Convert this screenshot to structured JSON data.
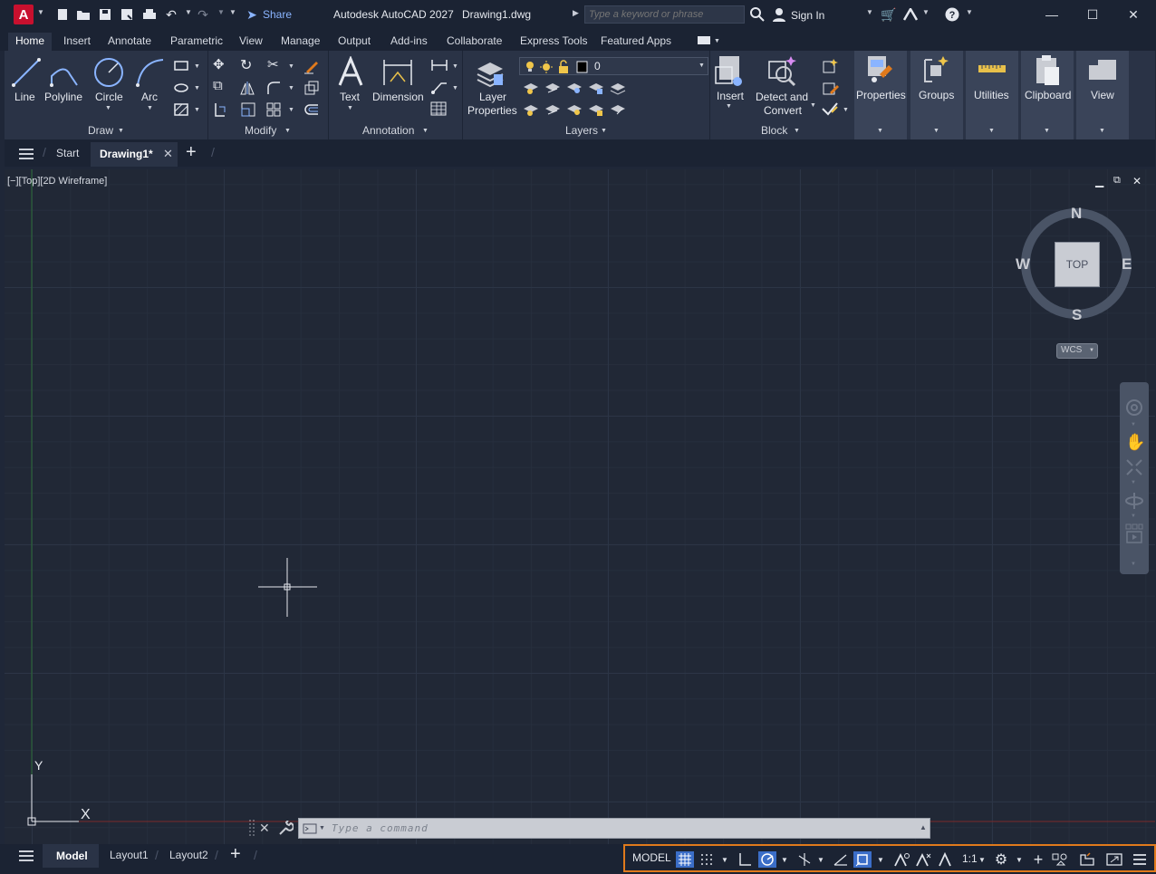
{
  "titlebar": {
    "app_logo": "A",
    "share_label": "Share",
    "app_title": "Autodesk AutoCAD 2027",
    "doc_title": "Drawing1.dwg",
    "search_placeholder": "Type a keyword or phrase",
    "signin_label": "Sign In"
  },
  "ribbon_tabs": [
    "Home",
    "Insert",
    "Annotate",
    "Parametric",
    "View",
    "Manage",
    "Output",
    "Add-ins",
    "Collaborate",
    "Express Tools",
    "Featured Apps"
  ],
  "active_tab": "Home",
  "ribbon": {
    "draw": {
      "title": "Draw",
      "line": "Line",
      "polyline": "Polyline",
      "circle": "Circle",
      "arc": "Arc"
    },
    "modify": {
      "title": "Modify"
    },
    "annotation": {
      "title": "Annotation",
      "text": "Text",
      "dimension": "Dimension"
    },
    "layers": {
      "title": "Layers",
      "layer_props_1": "Layer",
      "layer_props_2": "Properties",
      "current_layer": "0"
    },
    "block": {
      "title": "Block",
      "insert": "Insert",
      "detect_1": "Detect and",
      "detect_2": "Convert"
    },
    "properties": "Properties",
    "groups": "Groups",
    "utilities": "Utilities",
    "clipboard": "Clipboard",
    "view": "View"
  },
  "filetabs": {
    "start": "Start",
    "drawing": "Drawing1*"
  },
  "viewport": {
    "view_label": "[−][Top][2D Wireframe]",
    "viewcube": {
      "top": "TOP",
      "north": "N",
      "south": "S",
      "east": "E",
      "west": "W",
      "wcs": "WCS"
    },
    "ucs_y": "Y",
    "ucs_x": "X"
  },
  "command_line": {
    "placeholder": "Type a command"
  },
  "layout_tabs": [
    "Model",
    "Layout1",
    "Layout2"
  ],
  "statusbar": {
    "model": "MODEL",
    "scale": "1:1"
  },
  "colors": {
    "accent": "#3b6ec8",
    "status_highlight": "#e07a1c",
    "logo": "#c8102e"
  }
}
